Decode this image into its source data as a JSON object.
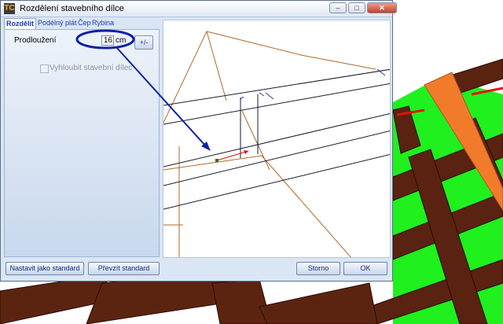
{
  "window": {
    "title": "Rozdělení stavebního dílce",
    "icon": "tc-app-icon"
  },
  "window_controls": {
    "minimize": "–",
    "maximize": "□",
    "close": "✕"
  },
  "tabs": [
    {
      "label": "Rozdělit",
      "active": true
    },
    {
      "label": "Podélný plát",
      "active": false
    },
    {
      "label": "Čep",
      "active": false
    },
    {
      "label": "Rybina",
      "active": false
    }
  ],
  "form": {
    "extension_label": "Prodloužení",
    "extension_value": "16",
    "extension_unit": "cm",
    "toggle_sign_label": "+/-",
    "hollow_checkbox_label": "Vyhloubit stavební dílec",
    "hollow_checked": false,
    "hollow_enabled": false
  },
  "footer": {
    "set_default_label": "Nastavit jako standard",
    "load_default_label": "Převzít standard",
    "cancel_label": "Storno",
    "ok_label": "OK"
  },
  "colors": {
    "dialog_bg": "#dbe6f4",
    "annotation": "#1020a8",
    "roof_wood": "#6b2a12",
    "green_surface": "#19f01a",
    "orange_beam": "#f07a2a"
  }
}
